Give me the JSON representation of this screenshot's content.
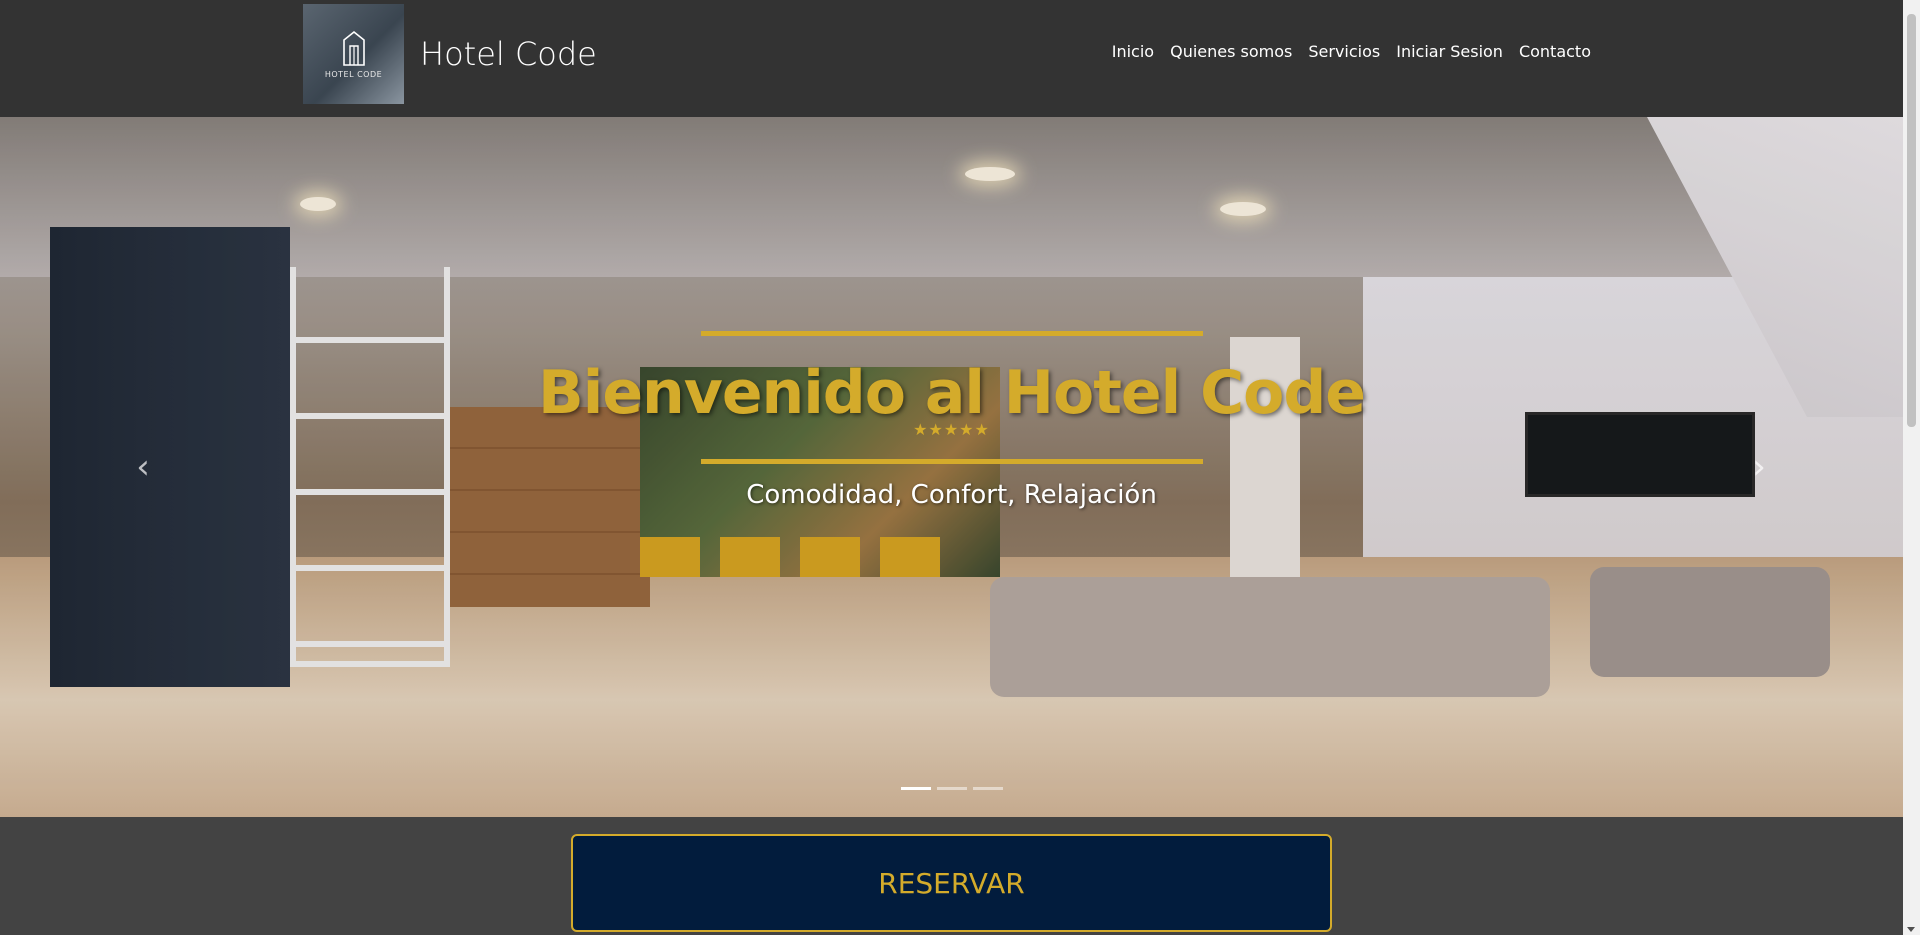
{
  "header": {
    "logo_text": "HOTEL CODE",
    "brand_name": "Hotel Code",
    "nav": [
      {
        "label": "Inicio"
      },
      {
        "label": "Quienes somos"
      },
      {
        "label": "Servicios"
      },
      {
        "label": "Iniciar Sesion"
      },
      {
        "label": "Contacto"
      }
    ]
  },
  "hero": {
    "title": "Bienvenido al Hotel Code",
    "stars": "★★★★★",
    "subtitle": "Comodidad, Confort, Relajación",
    "prev_icon": "‹",
    "next_icon": "›",
    "slides": 3,
    "active_slide": 1
  },
  "reserve": {
    "label": "RESERVAR"
  },
  "colors": {
    "accent_gold": "#d4ab2b",
    "header_bg": "#333333",
    "page_bg": "#434343",
    "button_bg": "#021c3d"
  }
}
